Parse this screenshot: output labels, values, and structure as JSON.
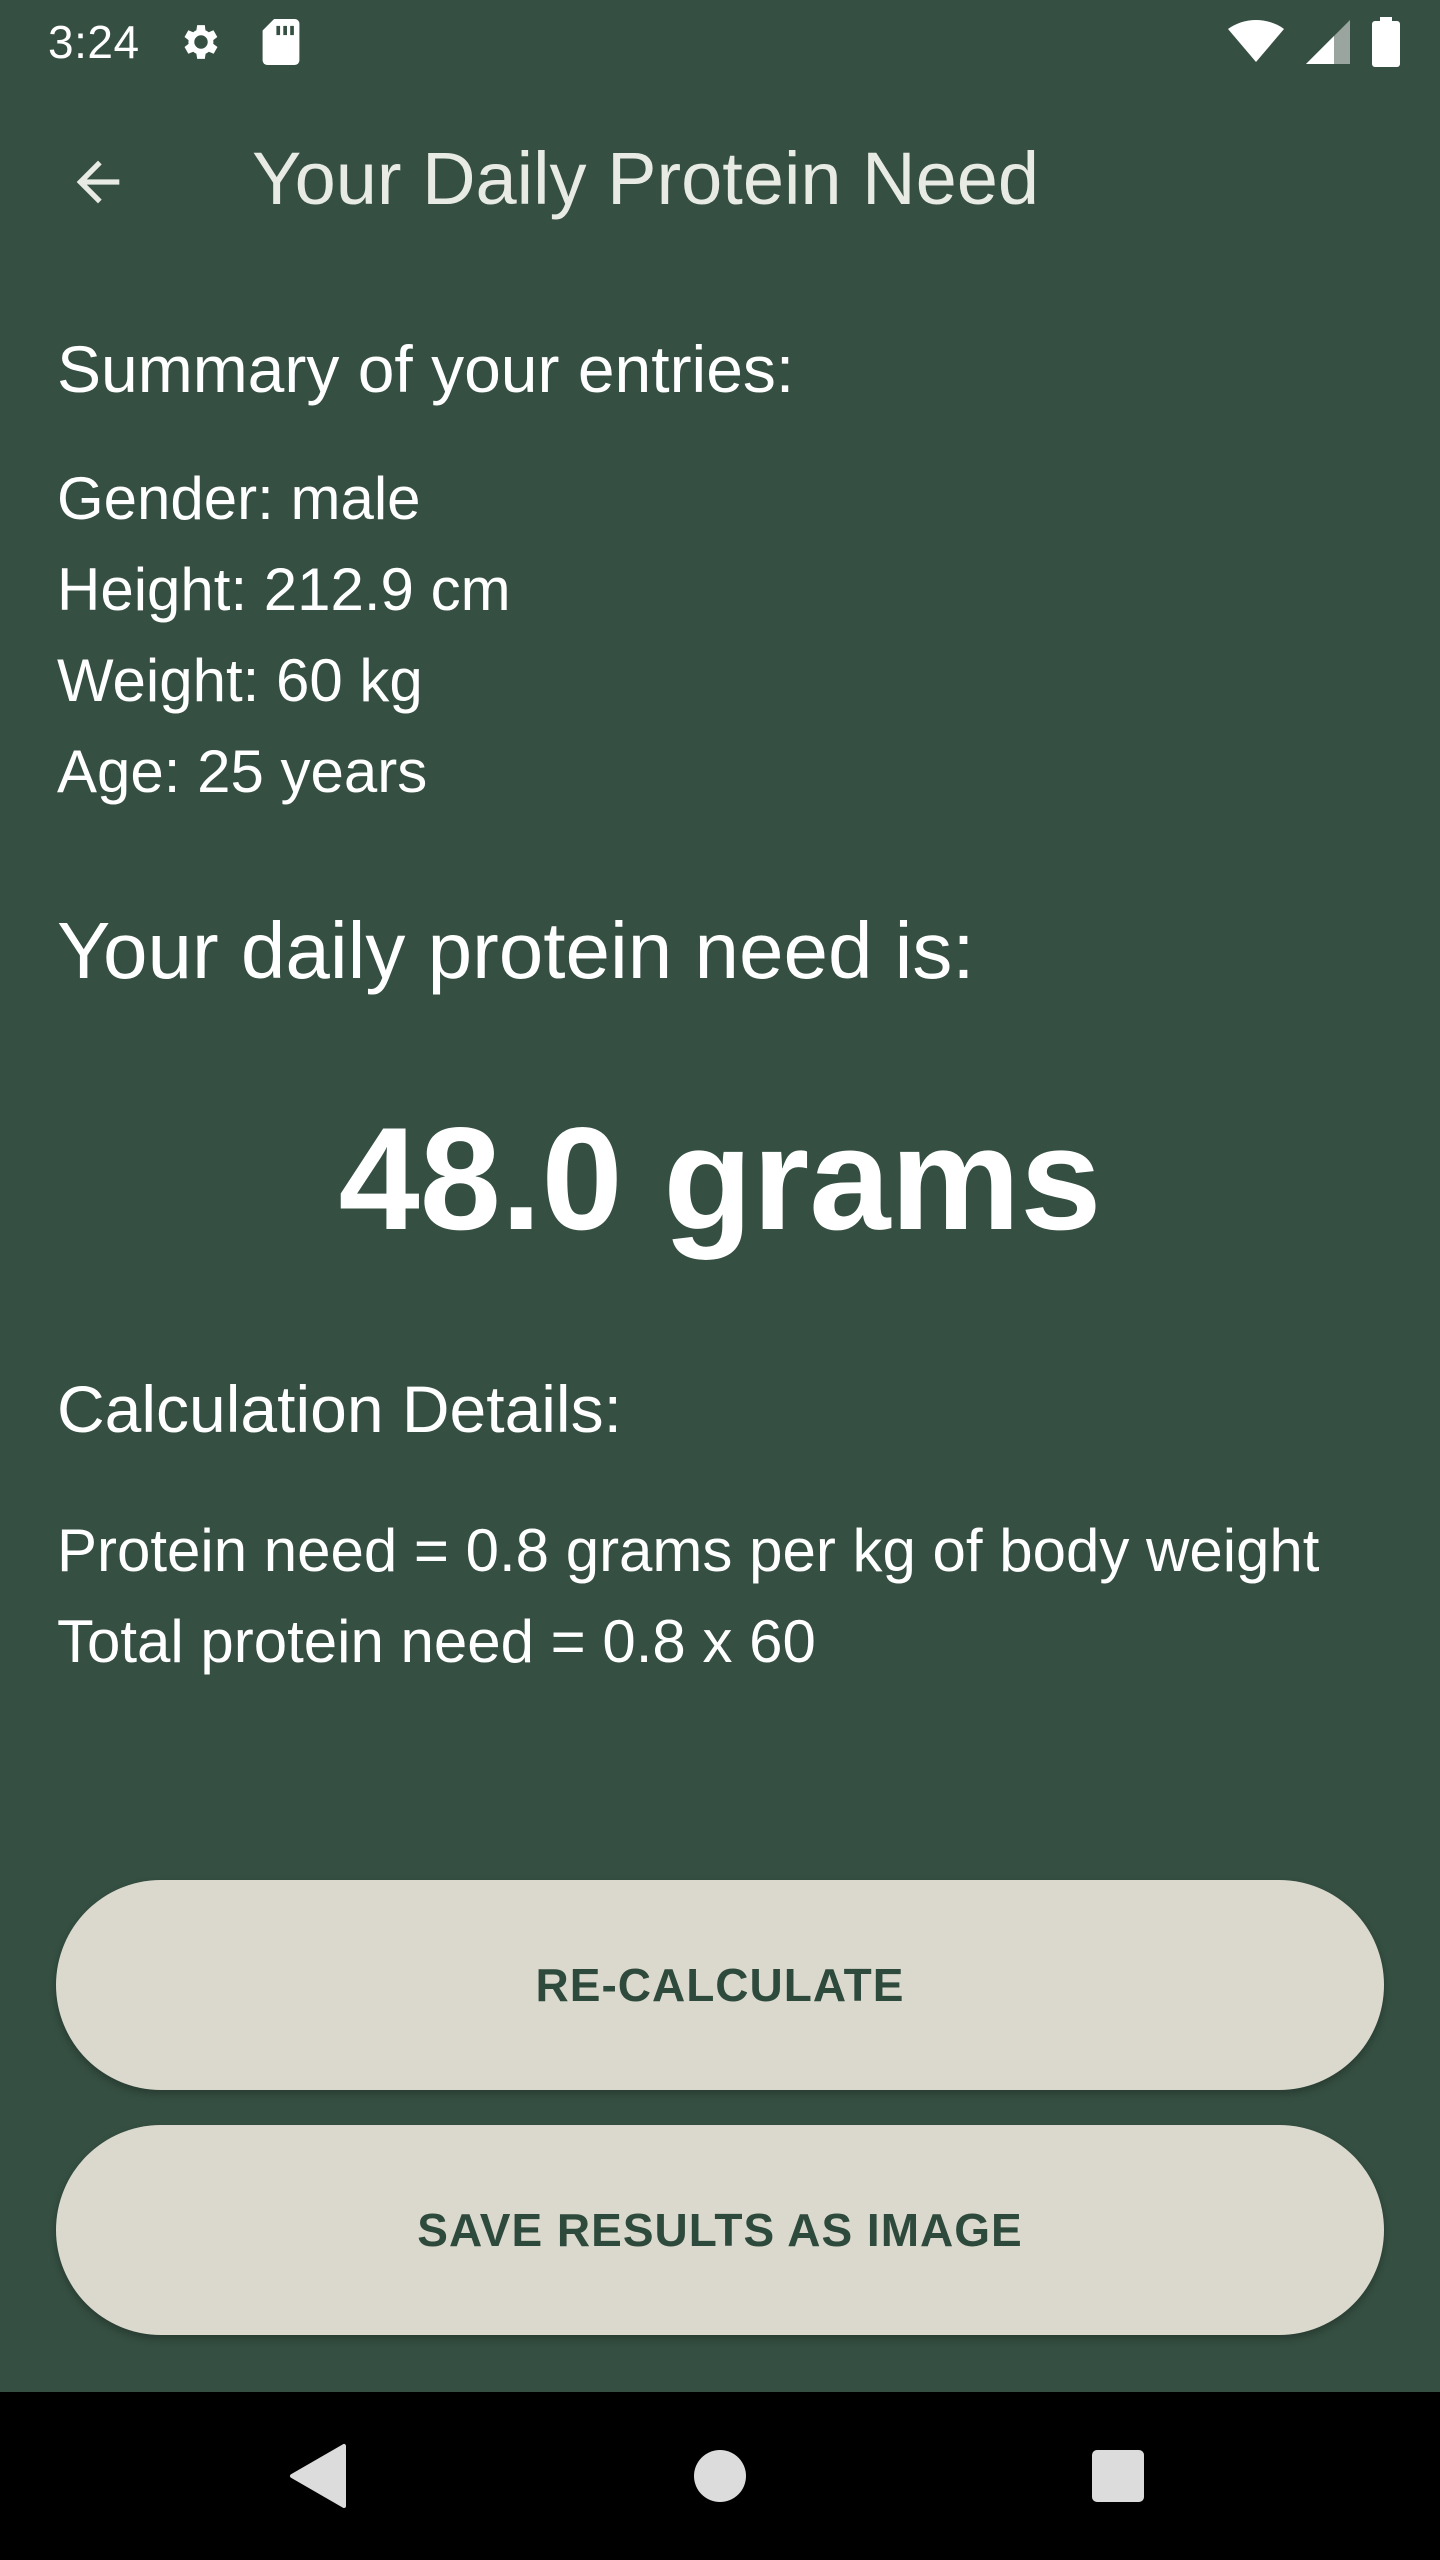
{
  "status_bar": {
    "time": "3:24",
    "icons": [
      "gear-icon",
      "sd-card-icon",
      "wifi-icon",
      "signal-icon",
      "battery-icon"
    ]
  },
  "app_bar": {
    "title": "Your Daily Protein Need",
    "back_icon": "arrow-left-icon"
  },
  "summary": {
    "heading": "Summary of your entries:",
    "gender": "Gender: male",
    "height": "Height: 212.9 cm",
    "weight": "Weight: 60 kg",
    "age": "Age: 25 years"
  },
  "result": {
    "heading": "Your daily protein need is:",
    "value": "48.0 grams"
  },
  "calculation": {
    "heading": "Calculation Details:",
    "line1": "Protein need = 0.8 grams per kg of body weight",
    "line2": "Total protein need = 0.8 x 60"
  },
  "buttons": {
    "recalculate": "RE-CALCULATE",
    "save": "SAVE RESULTS AS IMAGE"
  },
  "nav_bar": {
    "icons": [
      "nav-back-icon",
      "nav-home-icon",
      "nav-recents-icon"
    ]
  },
  "colors": {
    "background": "#354f42",
    "button_bg": "#dbd9cd",
    "button_text": "#2e4a3c",
    "nav_bar": "#000000"
  }
}
